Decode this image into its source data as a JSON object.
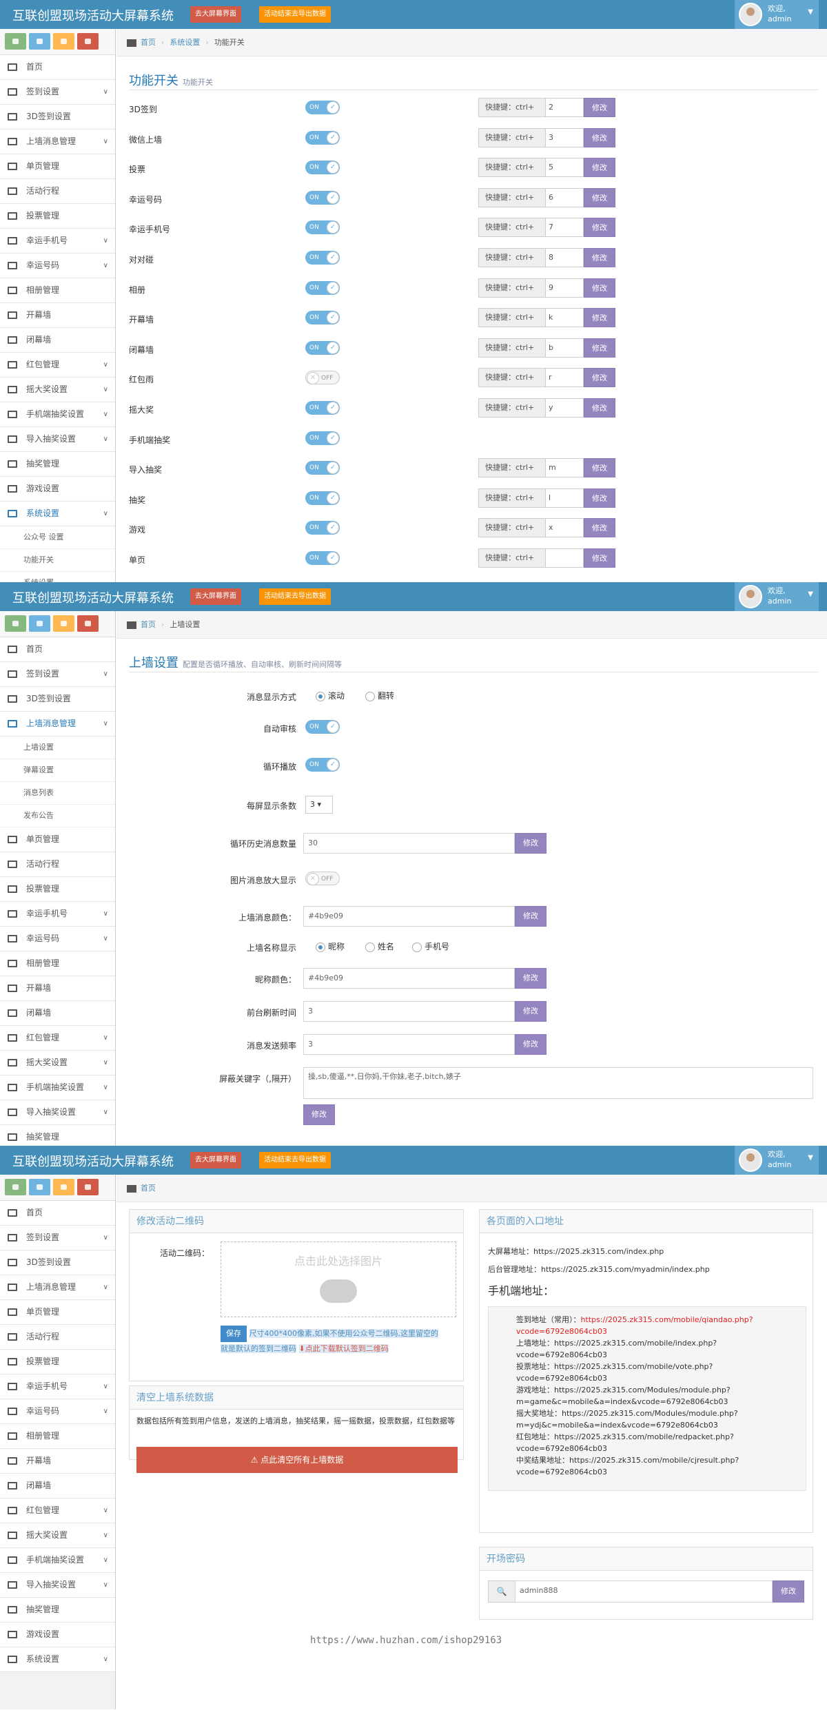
{
  "header": {
    "title": "互联创盟现场活动大屏幕系统",
    "btn_screen": "去大屏幕界面",
    "btn_clear": "活动结束去导出数据",
    "welcome": "欢迎,",
    "username": "admin"
  },
  "sidebar": {
    "items": {
      "home": "首页",
      "signin": "签到设置",
      "signin3d": "3D签到设置",
      "wall": "上墙消息管理",
      "single": "单页管理",
      "schedule": "活动行程",
      "vote": "投票管理",
      "luckyphone": "幸运手机号",
      "luckynum": "幸运号码",
      "album": "相册管理",
      "opening": "开幕墙",
      "closing": "闭幕墙",
      "redpacket": "红包管理",
      "shake": "摇大奖设置",
      "phonelottery": "手机端抽奖设置",
      "importlottery": "导入抽奖设置",
      "lottery": "抽奖管理",
      "game": "游戏设置",
      "system": "系统设置"
    },
    "sys_sub": [
      "公众号 设置",
      "功能开关",
      "系统设置"
    ],
    "wall_sub": [
      "上墙设置",
      "弹幕设置",
      "消息列表",
      "发布公告"
    ]
  },
  "screen1": {
    "breadcrumb": [
      "首页",
      "系统设置",
      "功能开关"
    ],
    "title": "功能开关",
    "subtitle": "功能开关",
    "shortcut_label": "快捷键：ctrl+",
    "modify": "修改",
    "on": "ON",
    "off": "OFF",
    "rows": [
      {
        "label": "3D签到",
        "on": true,
        "key": "2",
        "shortcut": true
      },
      {
        "label": "微信上墙",
        "on": true,
        "key": "3",
        "shortcut": true
      },
      {
        "label": "投票",
        "on": true,
        "key": "5",
        "shortcut": true
      },
      {
        "label": "幸运号码",
        "on": true,
        "key": "6",
        "shortcut": true
      },
      {
        "label": "幸运手机号",
        "on": true,
        "key": "7",
        "shortcut": true
      },
      {
        "label": "对对碰",
        "on": true,
        "key": "8",
        "shortcut": true
      },
      {
        "label": "相册",
        "on": true,
        "key": "9",
        "shortcut": true
      },
      {
        "label": "开幕墙",
        "on": true,
        "key": "k",
        "shortcut": true
      },
      {
        "label": "闭幕墙",
        "on": true,
        "key": "b",
        "shortcut": true
      },
      {
        "label": "红包雨",
        "on": false,
        "key": "r",
        "shortcut": true
      },
      {
        "label": "摇大奖",
        "on": true,
        "key": "y",
        "shortcut": true
      },
      {
        "label": "手机端抽奖",
        "on": true,
        "key": "",
        "shortcut": false
      },
      {
        "label": "导入抽奖",
        "on": true,
        "key": "m",
        "shortcut": true
      },
      {
        "label": "抽奖",
        "on": true,
        "key": "l",
        "shortcut": true
      },
      {
        "label": "游戏",
        "on": true,
        "key": "x",
        "shortcut": true
      },
      {
        "label": "单页",
        "on": true,
        "key": "",
        "shortcut": true
      }
    ]
  },
  "screen2": {
    "breadcrumb": [
      "首页",
      "上墙设置"
    ],
    "title": "上墙设置",
    "subtitle": "配置是否循环播放、自动审核、刷新时间间隔等",
    "display_mode_label": "消息显示方式",
    "display_modes": [
      "滚动",
      "翻转"
    ],
    "auto_review_label": "自动审核",
    "loop_label": "循环播放",
    "per_screen_label": "每屏显示条数",
    "per_screen_value": "3",
    "history_label": "循环历史消息数量",
    "history_value": "30",
    "img_zoom_label": "图片消息放大显示",
    "msg_color_label": "上墙消息颜色：",
    "msg_color_value": "#4b9e09",
    "name_display_label": "上墙名称显示",
    "name_display_options": [
      "昵称",
      "姓名",
      "手机号"
    ],
    "nick_color_label": "昵称颜色：",
    "nick_color_value": "#4b9e09",
    "refresh_label": "前台刷新时间",
    "refresh_value": "3",
    "freq_label": "消息发送频率",
    "freq_value": "3",
    "keywords_label": "屏蔽关键字（,隔开）",
    "keywords_value": "操,sb,傻逼,**,日你妈,干你妹,老子,bitch,婊子",
    "modify": "修改",
    "on": "ON",
    "off": "OFF"
  },
  "screen3": {
    "breadcrumb": [
      "首页"
    ],
    "qr_panel_title": "修改活动二维码",
    "qr_label": "活动二维码：",
    "upload_text": "点击此处选择图片",
    "save": "保存",
    "qr_note_1": "尺寸400*400像素,如果不使用公众号二维码,这里留空的",
    "qr_note_2": "就是默认的签到二维码",
    "qr_download": "点此下载默认签到二维码",
    "clear_title": "清空上墙系统数据",
    "clear_desc": "数据包括所有签到用户信息，发送的上墙消息，抽奖结果，摇一摇数据，投票数据，红包数据等",
    "clear_btn": "点此清空所有上墙数据",
    "entry_title": "各页面的入口地址",
    "bigscreen": "大屏幕地址：https://2025.zk315.com/index.php",
    "backend": "后台管理地址：https://2025.zk315.com/myadmin/index.php",
    "mobile_title": "手机端地址：",
    "mobile_lines": [
      {
        "label": "签到地址（常用）：",
        "url": "https://2025.zk315.com/mobile/qiandao.php?",
        "red": true
      },
      {
        "label": "",
        "url": "vcode=6792e8064cb03",
        "red": true
      },
      {
        "label": "上墙地址：",
        "url": "https://2025.zk315.com/mobile/index.php?",
        "red": false
      },
      {
        "label": "",
        "url": "vcode=6792e8064cb03",
        "red": false
      },
      {
        "label": "投票地址：",
        "url": "https://2025.zk315.com/mobile/vote.php?",
        "red": false
      },
      {
        "label": "",
        "url": "vcode=6792e8064cb03",
        "red": false
      },
      {
        "label": "游戏地址：",
        "url": "https://2025.zk315.com/Modules/module.php?",
        "red": false
      },
      {
        "label": "",
        "url": "m=game&c=mobile&a=index&vcode=6792e8064cb03",
        "red": false
      },
      {
        "label": "摇大奖地址：",
        "url": "https://2025.zk315.com/Modules/module.php?",
        "red": false
      },
      {
        "label": "",
        "url": "m=ydj&c=mobile&a=index&vcode=6792e8064cb03",
        "red": false
      },
      {
        "label": "红包地址：",
        "url": "https://2025.zk315.com/mobile/redpacket.php?",
        "red": false
      },
      {
        "label": "",
        "url": "vcode=6792e8064cb03",
        "red": false
      },
      {
        "label": "中奖结果地址：",
        "url": "https://2025.zk315.com/mobile/cjresult.php?",
        "red": false
      },
      {
        "label": "",
        "url": "vcode=6792e8064cb03",
        "red": false
      }
    ],
    "pwd_title": "开场密码",
    "pwd_value": "admin888",
    "modify": "修改",
    "watermark": "https://www.huzhan.com/ishop29163"
  },
  "colors": {
    "topbar": "#438eb9",
    "accent_blue": "#2679b5",
    "btn_purple": "#9585bf",
    "danger": "#d15b47",
    "warning": "#f89406"
  }
}
